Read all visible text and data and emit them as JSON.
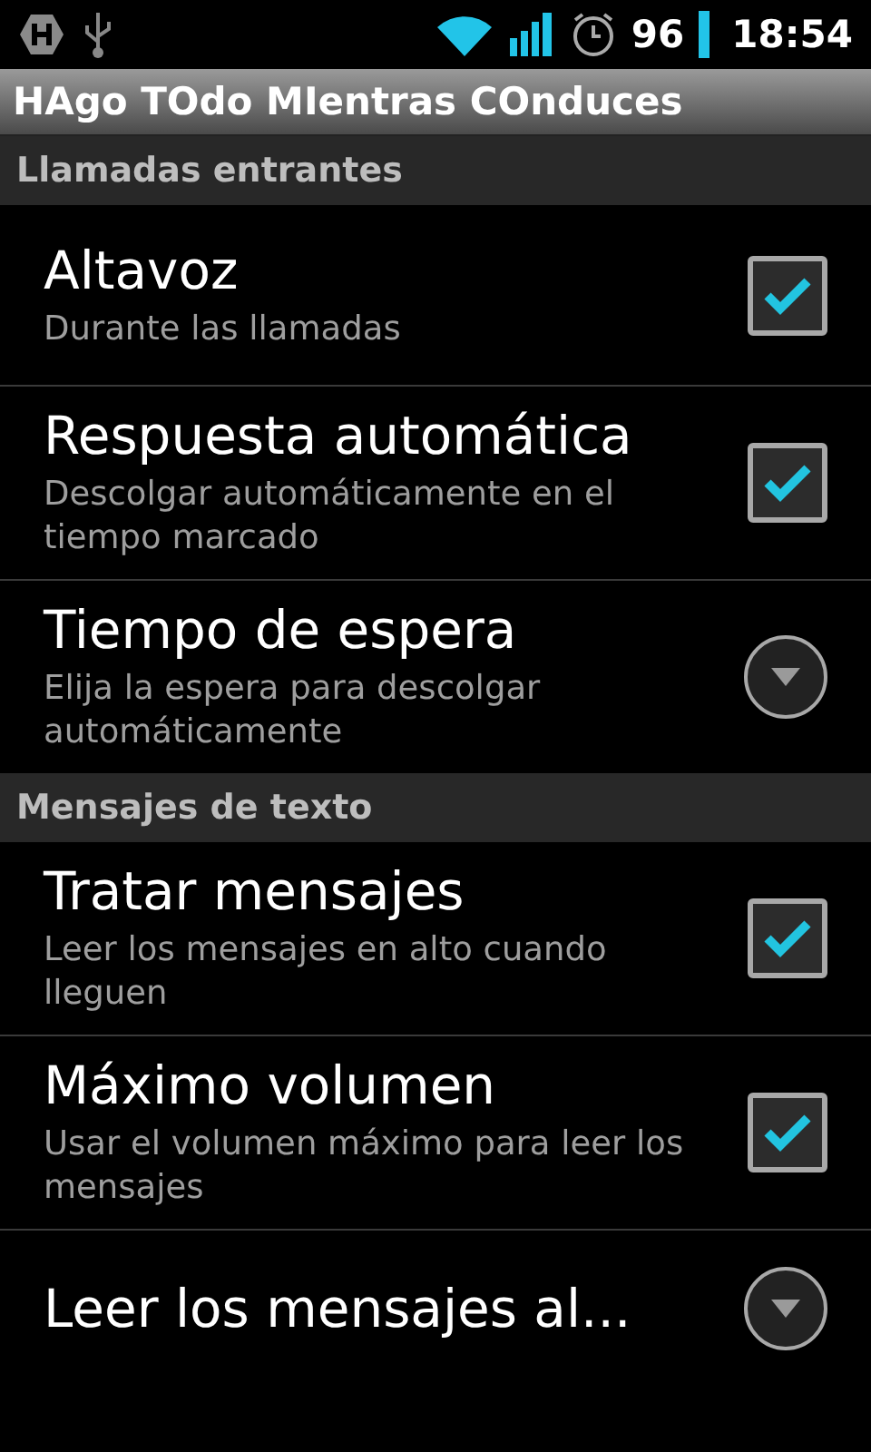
{
  "status_bar": {
    "battery": "96",
    "time": "18:54"
  },
  "window": {
    "title": "HAgo TOdo MIentras COnduces"
  },
  "sections": [
    {
      "header": "Llamadas entrantes",
      "items": [
        {
          "kind": "checkbox",
          "title": "Altavoz",
          "summary": "Durante las llamadas",
          "checked": true
        },
        {
          "kind": "checkbox",
          "title": "Respuesta automática",
          "summary": "Descolgar automáticamente en el tiempo marcado",
          "checked": true
        },
        {
          "kind": "list",
          "title": "Tiempo de espera",
          "summary": "Elija la espera para descolgar automáticamente"
        }
      ]
    },
    {
      "header": "Mensajes de texto",
      "items": [
        {
          "kind": "checkbox",
          "title": "Tratar mensajes",
          "summary": "Leer los mensajes en alto cuando lleguen",
          "checked": true
        },
        {
          "kind": "checkbox",
          "title": "Máximo volumen",
          "summary": "Usar el volumen máximo para leer los mensajes",
          "checked": true
        },
        {
          "kind": "list",
          "title": "Leer los mensajes al..."
        }
      ]
    }
  ]
}
